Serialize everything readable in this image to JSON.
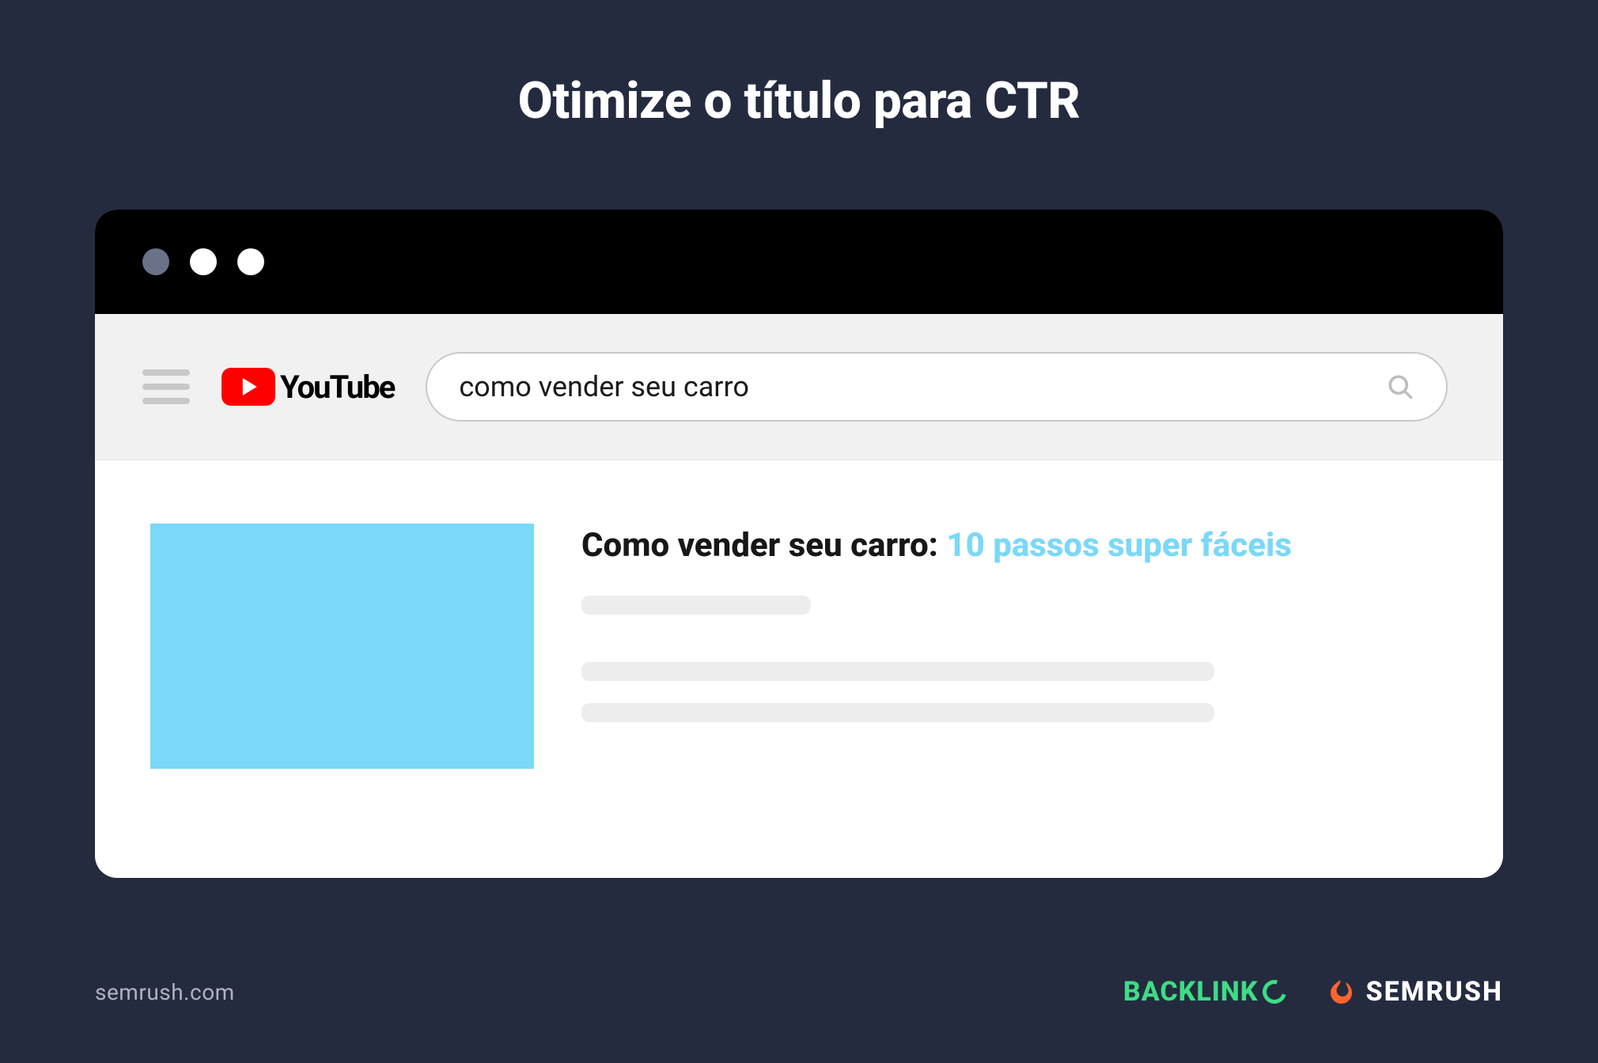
{
  "heading": "Otimize o título para CTR",
  "youtube": {
    "brand_label": "YouTube",
    "search_query": "como vender seu carro",
    "result": {
      "title_main": "Como vender seu carro: ",
      "title_highlight": "10 passos super fáceis"
    }
  },
  "footer": {
    "domain": "semrush.com",
    "brand1_prefix": "BACKLINK",
    "brand2": "SEMRUSH"
  },
  "colors": {
    "page_bg": "#252b3f",
    "highlight": "#7bd8f7",
    "backlinko": "#3edc84",
    "semrush_accent": "#ff642d"
  }
}
